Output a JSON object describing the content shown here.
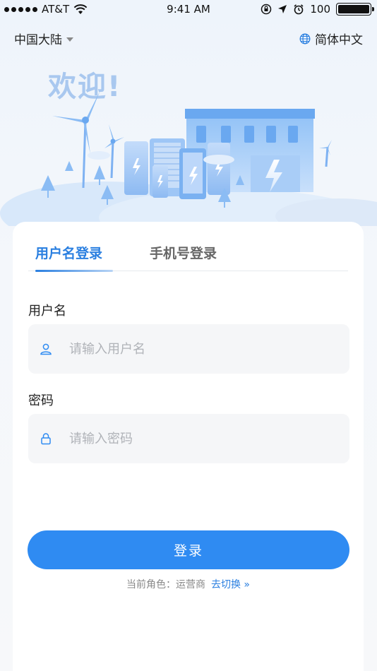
{
  "status_bar": {
    "carrier": "AT&T",
    "time": "9:41 AM",
    "battery": "100"
  },
  "topbar": {
    "region": "中国大陆",
    "language": "简体中文"
  },
  "hero": {
    "welcome": "欢迎!"
  },
  "tabs": [
    {
      "label": "用户名登录",
      "active": true
    },
    {
      "label": "手机号登录",
      "active": false
    }
  ],
  "form": {
    "username_label": "用户名",
    "username_placeholder": "请输入用户名",
    "password_label": "密码",
    "password_placeholder": "请输入密码",
    "login_label": "登录"
  },
  "role": {
    "text": "当前角色：运营商",
    "switch_label": "去切换 »"
  },
  "colors": {
    "accent": "#2f8bf2",
    "illustration": "#7fb2f2"
  }
}
